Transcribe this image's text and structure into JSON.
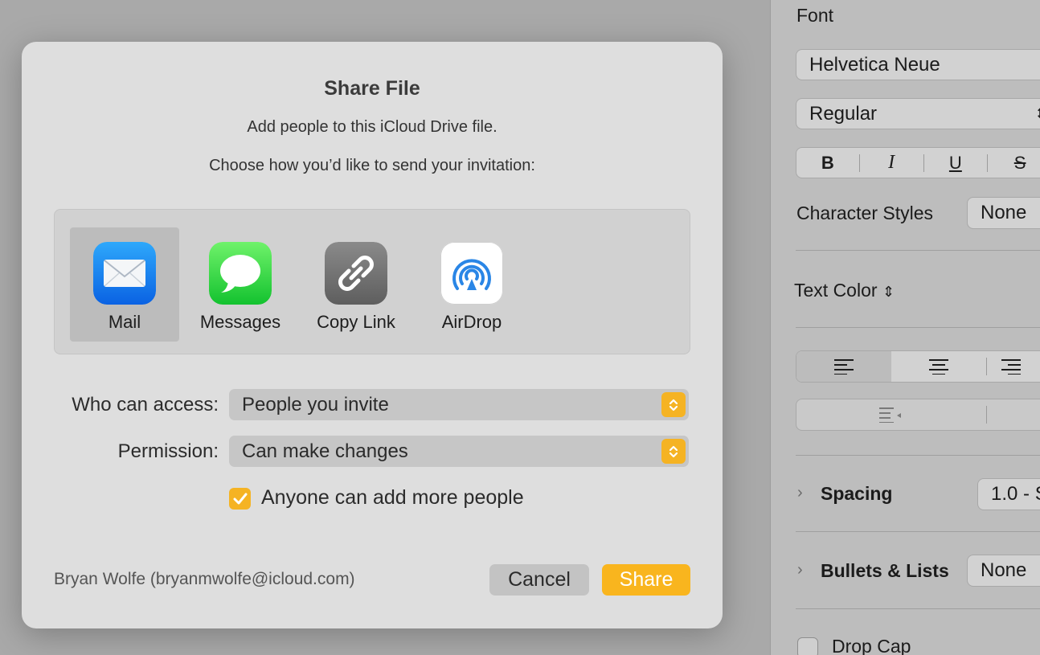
{
  "inspector": {
    "font_heading": "Font",
    "font_family": "Helvetica Neue",
    "font_style": "Regular",
    "style_buttons": [
      "B",
      "I",
      "U",
      "S"
    ],
    "character_styles_label": "Character Styles",
    "character_styles_value": "None",
    "text_color_label": "Text Color",
    "spacing_label": "Spacing",
    "spacing_value": "1.0 - S",
    "bullets_label": "Bullets & Lists",
    "bullets_value": "None",
    "drop_cap_label": "Drop Cap"
  },
  "dialog": {
    "title": "Share File",
    "subtitle": "Add people to this iCloud Drive file.",
    "instruction": "Choose how you’d like to send your invitation:",
    "services": [
      {
        "label": "Mail",
        "icon": "mail-icon",
        "selected": true
      },
      {
        "label": "Messages",
        "icon": "messages-icon",
        "selected": false
      },
      {
        "label": "Copy Link",
        "icon": "link-icon",
        "selected": false
      },
      {
        "label": "AirDrop",
        "icon": "airdrop-icon",
        "selected": false
      }
    ],
    "access_label": "Who can access:",
    "access_value": "People you invite",
    "permission_label": "Permission:",
    "permission_value": "Can make changes",
    "checkbox_label": "Anyone can add more people",
    "checkbox_checked": true,
    "account": "Bryan Wolfe (bryanmwolfe@icloud.com)",
    "cancel_label": "Cancel",
    "share_label": "Share"
  },
  "colors": {
    "accent": "#f9b51e",
    "sheet_background": "#dedede"
  }
}
